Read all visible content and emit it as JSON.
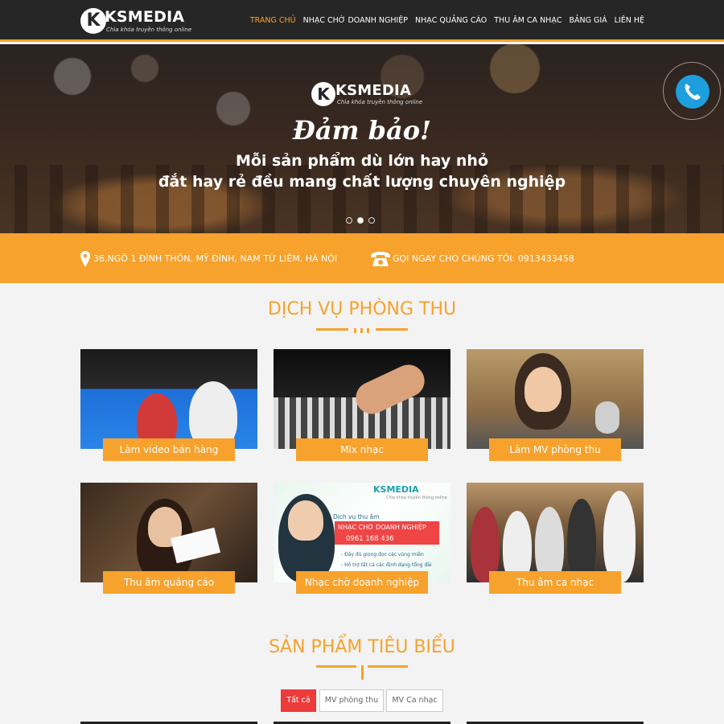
{
  "header": {
    "logo_letter": "K",
    "logo_text": "KSMEDIA",
    "logo_tagline": "Chìa khóa truyền thông online",
    "nav": [
      {
        "label": "TRANG CHỦ",
        "active": true
      },
      {
        "label": "NHẠC CHỜ DOANH NGHIỆP",
        "active": false
      },
      {
        "label": "NHẠC QUẢNG CÁO",
        "active": false
      },
      {
        "label": "THU ÂM CA NHẠC",
        "active": false
      },
      {
        "label": "BẢNG GIÁ",
        "active": false
      },
      {
        "label": "LIÊN HỆ",
        "active": false
      }
    ]
  },
  "hero": {
    "logo_letter": "K",
    "logo_text": "KSMEDIA",
    "logo_tagline": "Chìa khóa truyền thông online",
    "title": "Đảm bảo!",
    "line1": "Mỗi sản phẩm dù lớn hay nhỏ",
    "line2": "đắt hay rẻ đều mang chất lượng chuyên nghiệp",
    "slide_count": 3,
    "active_slide": 2
  },
  "info": {
    "address": "36,NGÕ 1 ĐÌNH THÔN, MỸ ĐÌNH, NAM TỪ LIÊM, HÀ NỘI",
    "phone": "GỌI NGAY CHO CHÚNG TÔI: 0913433458"
  },
  "services": {
    "title": "DỊCH VỤ PHÒNG THU",
    "items": [
      {
        "label": "Làm video bán hàng"
      },
      {
        "label": "Mix nhạc"
      },
      {
        "label": "Làm MV phòng thu"
      },
      {
        "label": "Thu âm quảng cáo"
      },
      {
        "label": "Nhạc chờ doanh nghiệp"
      },
      {
        "label": "Thu âm ca nhạc"
      }
    ],
    "ad": {
      "logo_text": "KSMEDIA",
      "tagline": "Chìa khóa truyền thông online",
      "line1": "Dịch vụ thu âm",
      "line2": "NHẠC CHỜ DOANH NGHIỆP",
      "line3": "0961 168 436",
      "bullet1": "- Đầy đủ giọng đọc các vùng miền",
      "bullet2": "- Hỗ trợ tất cả các định dạng tổng đài"
    }
  },
  "products": {
    "title": "SẢN PHẨM TIÊU BIỂU",
    "filters": [
      {
        "label": "Tất cả",
        "active": true
      },
      {
        "label": "MV phòng thu",
        "active": false
      },
      {
        "label": "MV Ca nhạc",
        "active": false
      }
    ]
  },
  "colors": {
    "accent": "#f6a22c",
    "header_bg": "#262626",
    "filter_active": "#ec3b3b",
    "phone_button": "#1e9fdd"
  },
  "icons": {
    "address": "map-pin-icon",
    "phone": "telephone-icon",
    "call": "phone-call-icon"
  }
}
